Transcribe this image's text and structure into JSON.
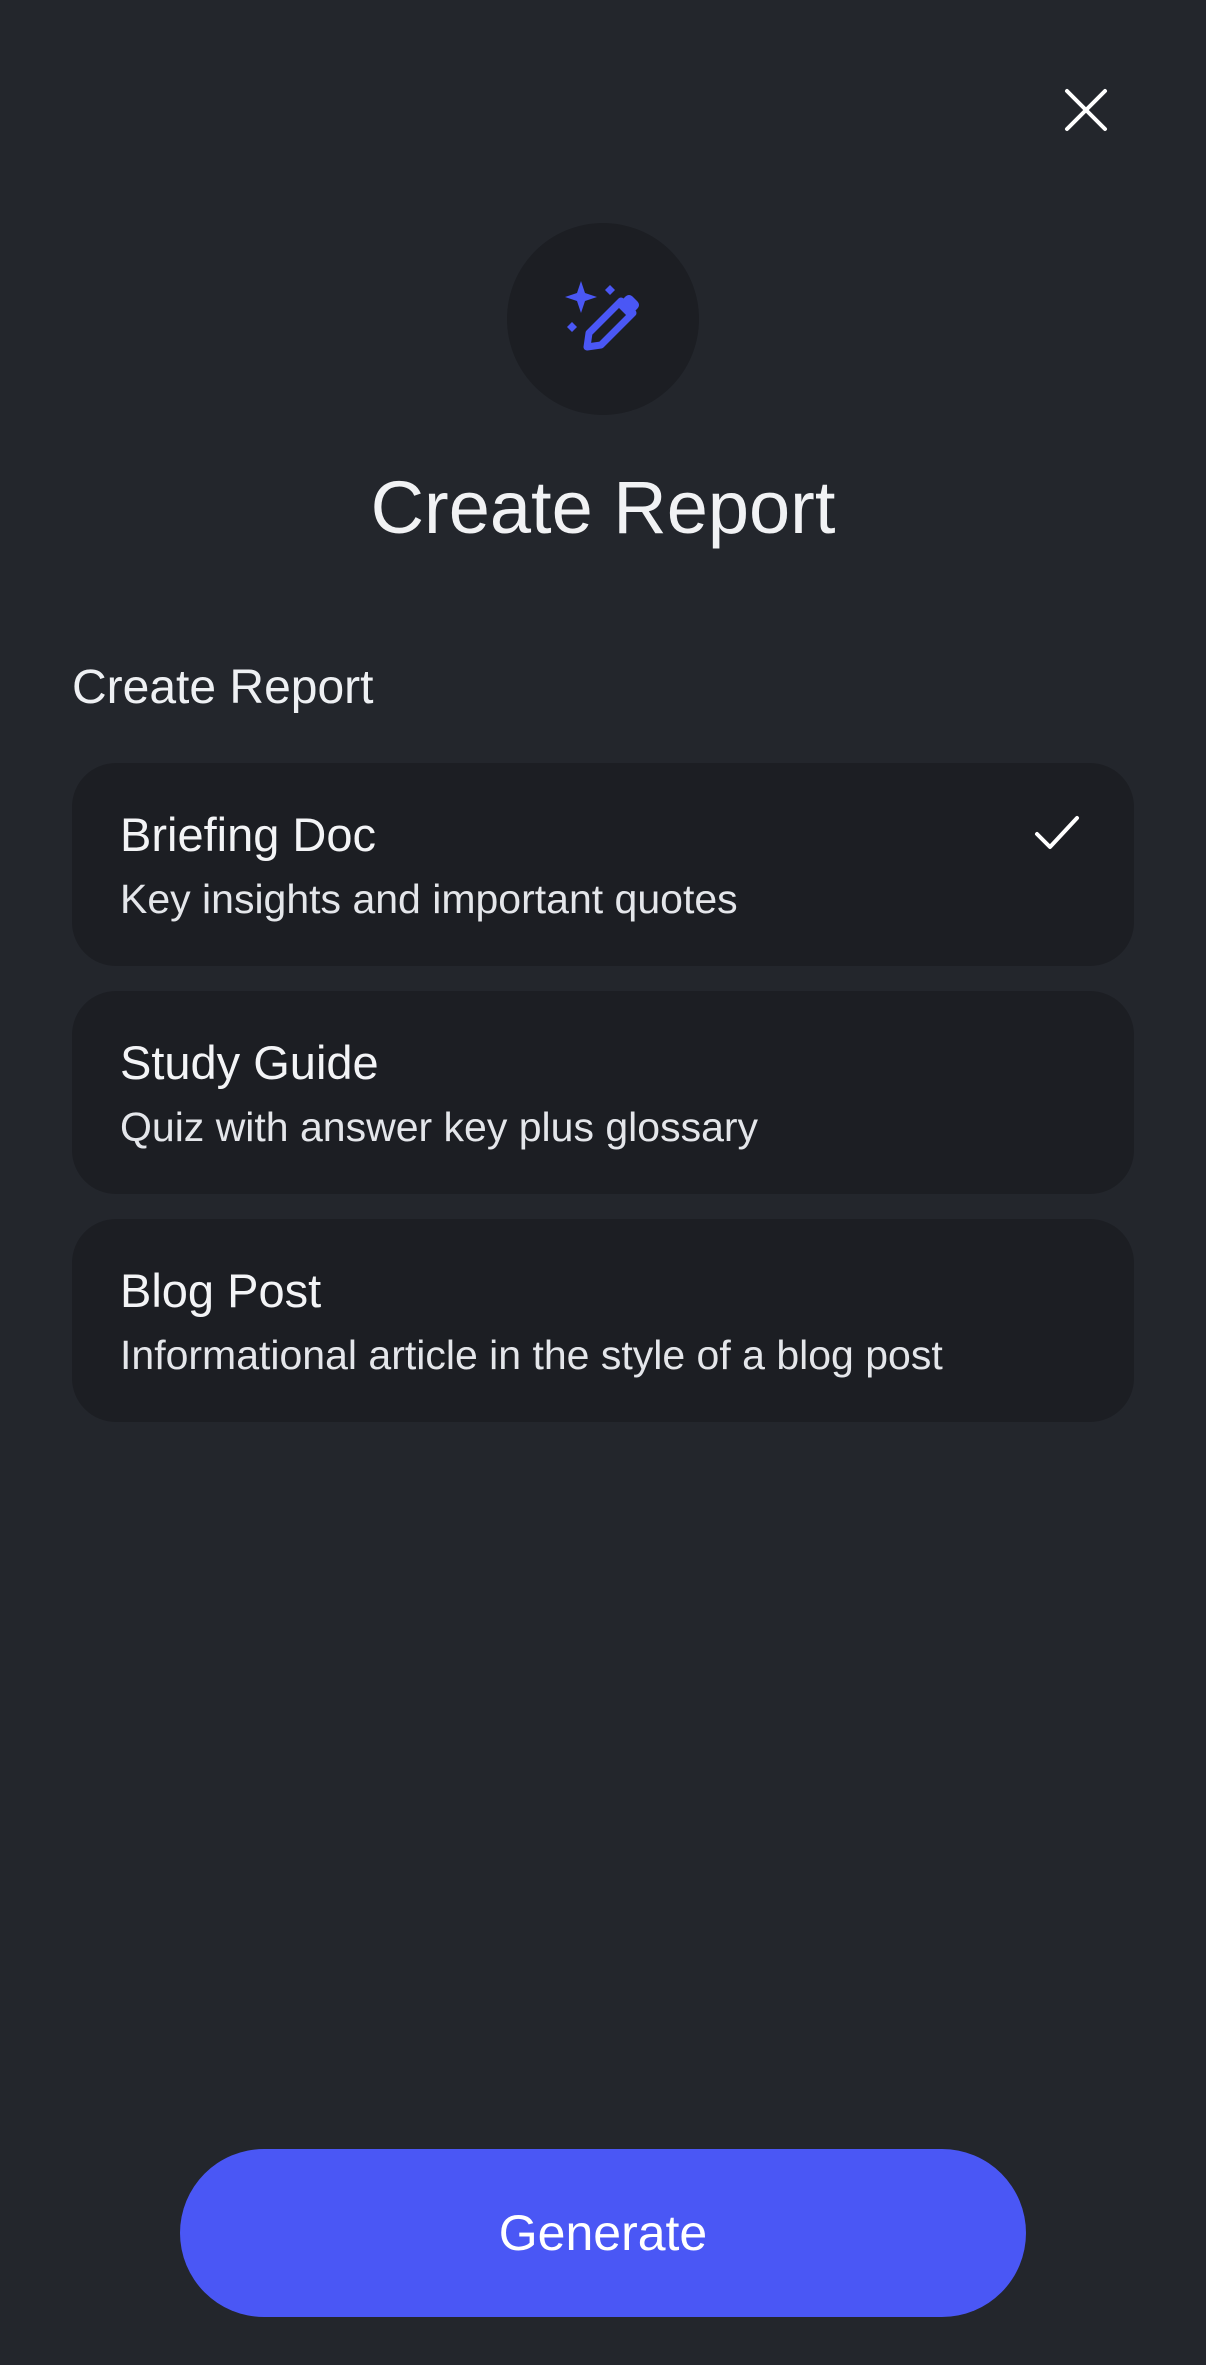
{
  "header": {
    "close_icon": "close-icon",
    "hero_icon": "magic-pen-icon",
    "title": "Create Report"
  },
  "section": {
    "label": "Create Report"
  },
  "options": [
    {
      "title": "Briefing Doc",
      "description": "Key insights and important quotes",
      "selected": true
    },
    {
      "title": "Study Guide",
      "description": "Quiz with answer key plus glossary",
      "selected": false
    },
    {
      "title": "Blog Post",
      "description": "Informational article in the style of a blog post",
      "selected": false
    }
  ],
  "footer": {
    "generate_label": "Generate"
  },
  "colors": {
    "background": "#23262c",
    "card": "#1c1e23",
    "accent": "#4a57f5",
    "text": "#f1f2f4"
  }
}
